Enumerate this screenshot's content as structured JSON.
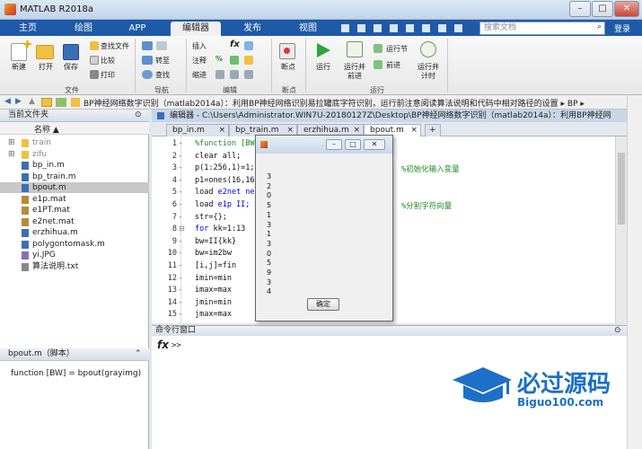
{
  "window": {
    "title": "MATLAB R2018a",
    "minimize": "–",
    "maximize": "□",
    "close": "✕"
  },
  "menu_tabs": [
    {
      "label": "主页"
    },
    {
      "label": "绘图"
    },
    {
      "label": "APP"
    },
    {
      "label": "编辑器"
    },
    {
      "label": "发布"
    },
    {
      "label": "视图"
    }
  ],
  "search": {
    "placeholder": "搜索文档"
  },
  "login": "登录",
  "ribbon": {
    "file": {
      "new": "新建",
      "open": "打开",
      "save": "保存",
      "find_files": "查找文件",
      "compare": "比较",
      "print": "打印",
      "group": "文件"
    },
    "navigate": {
      "goto": "转至",
      "find": "查找",
      "group": "导航"
    },
    "edit": {
      "insert": "插入",
      "fx": "fx",
      "comment": "注释",
      "comment_mark": "%",
      "indent": "缩进",
      "group": "编辑"
    },
    "breakpoint": {
      "label": "断点",
      "group": "断点"
    },
    "run": {
      "run": "运行",
      "run_advance_1": "运行并",
      "run_advance_2": "前进",
      "run_section": "运行节",
      "advance": "前进",
      "run_time_1": "运行并",
      "run_time_2": "计时",
      "group": "运行"
    }
  },
  "address": {
    "path": "BP神经网络数字识别（matlab2014a）：利用BP神经网络识别易拉罐底字符识别，运行前注意阅读算法说明和代码中相对路径的设置 ▸ BP ▸"
  },
  "current_folder": {
    "title": "当前文件夹",
    "column": "名称 ▲",
    "items": [
      {
        "name": "train",
        "type": "folder",
        "selected": false
      },
      {
        "name": "zifu",
        "type": "folder",
        "selected": false
      },
      {
        "name": "bp_in.m",
        "type": "m",
        "selected": false
      },
      {
        "name": "bp_train.m",
        "type": "m",
        "selected": false
      },
      {
        "name": "bpout.m",
        "type": "m",
        "selected": true
      },
      {
        "name": "e1p.mat",
        "type": "mat",
        "selected": false
      },
      {
        "name": "e1PT.mat",
        "type": "mat",
        "selected": false
      },
      {
        "name": "e2net.mat",
        "type": "mat",
        "selected": false
      },
      {
        "name": "erzhihua.m",
        "type": "m",
        "selected": false
      },
      {
        "name": "polygontomask.m",
        "type": "m",
        "selected": false
      },
      {
        "name": "yi.JPG",
        "type": "jpg",
        "selected": false
      },
      {
        "name": "算法说明.txt",
        "type": "txt",
        "selected": false
      }
    ]
  },
  "details": {
    "title": "bpout.m（脚本）",
    "signature": "function [BW]  = bpout(grayimg)"
  },
  "editor": {
    "header": "编辑器 - C:\\Users\\Administrator.WIN7U-20180127Z\\Desktop\\BP神经网络数字识别（matlab2014a）：利用BP神经网",
    "tabs": [
      {
        "label": "bp_in.m",
        "close": "×"
      },
      {
        "label": "bp_train.m",
        "close": "×"
      },
      {
        "label": "erzhihua.m",
        "close": "×"
      },
      {
        "label": "bpout.m",
        "close": "×"
      }
    ],
    "new_tab": "+",
    "line_numbers": [
      "1",
      "2",
      "3",
      "4",
      "5",
      "6",
      "7",
      "8",
      "9",
      "10",
      "11",
      "12",
      "13",
      "14",
      "15"
    ],
    "lines": [
      {
        "pre": "%function [BW]",
        "kw": "",
        "post": "",
        "comment": ""
      },
      {
        "pre": "clear all;",
        "kw": "",
        "post": "",
        "comment": ""
      },
      {
        "pre": "p(1:256,1)=1;",
        "kw": "",
        "post": "",
        "comment": "%初始化输入变量"
      },
      {
        "pre": "p1=ones(16,16",
        "kw": "",
        "post": "",
        "comment": ""
      },
      {
        "pre": "load ",
        "kw": "e2net ne",
        "post": "",
        "comment": ""
      },
      {
        "pre": "load ",
        "kw": "e1p II;",
        "post": "",
        "comment": "%分割字符向量"
      },
      {
        "pre": "str={};",
        "kw": "",
        "post": "",
        "comment": ""
      },
      {
        "pre": "",
        "kw": "for",
        "post": " kk=1:13",
        "comment": ""
      },
      {
        "pre": "    bw=II{kk}",
        "kw": "",
        "post": "",
        "comment": ""
      },
      {
        "pre": "    bw=im2bw",
        "kw": "",
        "post": "",
        "comment": ""
      },
      {
        "pre": "    [i,j]=fin",
        "kw": "",
        "post": "",
        "comment": ""
      },
      {
        "pre": "    imin=min",
        "kw": "",
        "post": "",
        "comment": ""
      },
      {
        "pre": "    imax=max",
        "kw": "",
        "post": "",
        "comment": ""
      },
      {
        "pre": "    jmin=min",
        "kw": "",
        "post": "",
        "comment": ""
      },
      {
        "pre": "    jmax=max",
        "kw": "",
        "post": "",
        "comment": ""
      }
    ]
  },
  "command_window": {
    "title": "命令行窗口",
    "fx": "fx",
    "prompt": ">>"
  },
  "dialog": {
    "digits": [
      "3",
      "2",
      "0",
      "5",
      "1",
      "3",
      "1",
      "3",
      "0",
      "5",
      "9",
      "3",
      "4"
    ],
    "ok": "确定"
  },
  "watermark": {
    "brand": "必过源码",
    "url": "Biguo100.com"
  }
}
